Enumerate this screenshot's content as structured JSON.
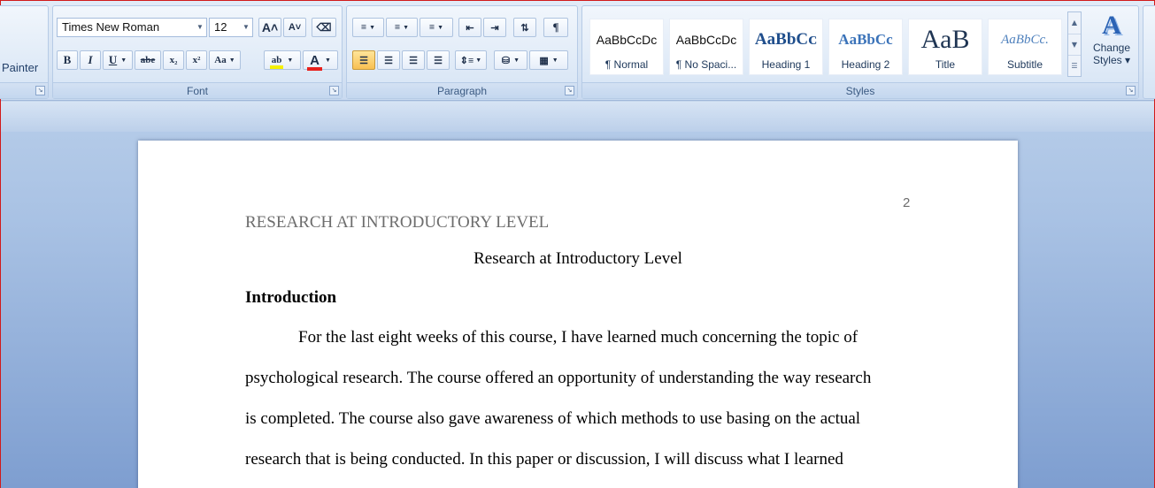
{
  "clipboard": {
    "painter_label": "Painter"
  },
  "font": {
    "group_label": "Font",
    "font_name": "Times New Roman",
    "font_size": "12",
    "grow_label": "A˄",
    "shrink_label": "A˅",
    "bold": "B",
    "italic": "I",
    "underline": "U",
    "strikethrough": "abe",
    "subscript": "x₂",
    "superscript": "x²",
    "change_case": "Aa",
    "highlight": "ab",
    "font_color": "A",
    "font_color_value": "#e8201c",
    "highlight_color_value": "#f5f000"
  },
  "paragraph": {
    "group_label": "Paragraph"
  },
  "styles": {
    "group_label": "Styles",
    "items": [
      {
        "preview": "AaBbCcDc",
        "name": "¶ Normal"
      },
      {
        "preview": "AaBbCcDc",
        "name": "¶ No Spaci..."
      },
      {
        "preview": "AaBbCᴄ",
        "name": "Heading 1"
      },
      {
        "preview": "AaBbCc",
        "name": "Heading 2"
      },
      {
        "preview": "AaB",
        "name": "Title"
      },
      {
        "preview": "AaBbCc.",
        "name": "Subtitle"
      }
    ],
    "change_styles_line1": "Change",
    "change_styles_line2": "Styles ▾",
    "heading_color": "#1f4e8c"
  },
  "document": {
    "running_head": "RESEARCH AT INTRODUCTORY LEVEL",
    "page_number": "2",
    "title": "Research at Introductory Level",
    "heading": "Introduction",
    "lines": [
      "For the last eight weeks of this course, I have learned much concerning the topic of",
      "psychological research. The course offered an opportunity of understanding the way research",
      "is completed. The course also gave awareness of which methods to use basing on the actual",
      "research that is being conducted. In this paper or discussion, I will discuss what I learned"
    ]
  }
}
